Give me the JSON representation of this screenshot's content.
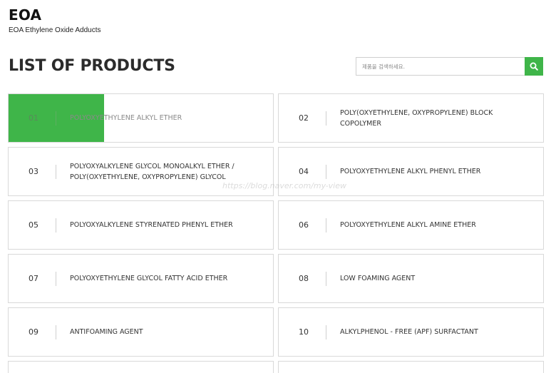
{
  "brand": {
    "title": "EOA",
    "subtitle": "EOA Ethylene Oxide Adducts"
  },
  "page": {
    "heading": "LIST OF PRODUCTS"
  },
  "search": {
    "placeholder": "제품을 검색하세요.",
    "button_icon": "search-icon"
  },
  "accent_color": "#3fb549",
  "products": [
    {
      "num": "01",
      "label": "POLYOXYETHYLENE ALKYL ETHER"
    },
    {
      "num": "02",
      "label": "POLY(OXYETHYLENE, OXYPROPYLENE) BLOCK COPOLYMER"
    },
    {
      "num": "03",
      "label": "POLYOXYALKYLENE GLYCOL MONOALKYL ETHER / POLY(OXYETHYLENE, OXYPROPYLENE) GLYCOL"
    },
    {
      "num": "04",
      "label": "POLYOXYETHYLENE ALKYL PHENYL ETHER"
    },
    {
      "num": "05",
      "label": "POLYOXYALKYLENE STYRENATED PHENYL ETHER"
    },
    {
      "num": "06",
      "label": "POLYOXYETHYLENE ALKYL AMINE ETHER"
    },
    {
      "num": "07",
      "label": "POLYOXYETHYLENE GLYCOL FATTY ACID ETHER"
    },
    {
      "num": "08",
      "label": "LOW FOAMING AGENT"
    },
    {
      "num": "09",
      "label": "ANTIFOAMING AGENT"
    },
    {
      "num": "10",
      "label": "ALKYLPHENOL - FREE (APF) SURFACTANT"
    }
  ],
  "watermark": "https://blog.naver.com/my-view"
}
